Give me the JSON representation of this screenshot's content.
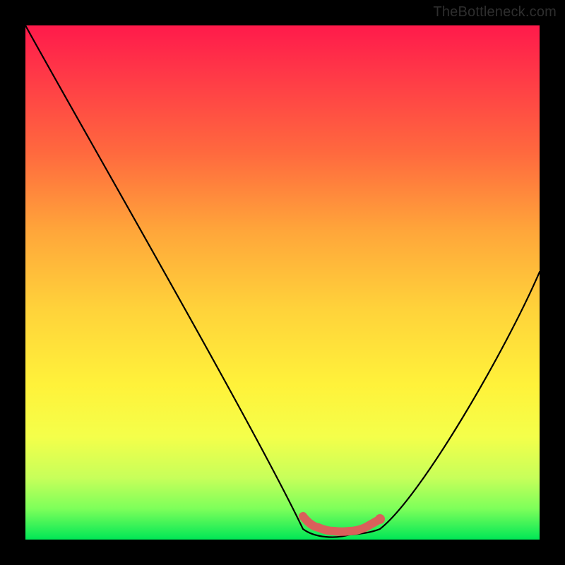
{
  "attribution": "TheBottleneck.com",
  "chart_data": {
    "type": "line",
    "title": "",
    "xlabel": "",
    "ylabel": "",
    "xlim": [
      0,
      100
    ],
    "ylim": [
      0,
      100
    ],
    "grid": false,
    "series": [
      {
        "name": "curve",
        "color": "#000000",
        "x": [
          0,
          54,
          63,
          69,
          100
        ],
        "y": [
          100,
          2,
          1,
          2,
          52
        ]
      },
      {
        "name": "highlight",
        "color": "#d9605b",
        "x": [
          54,
          57,
          60,
          63,
          66,
          69
        ],
        "y": [
          4.5,
          2.3,
          1.6,
          1.6,
          2.3,
          4.0
        ]
      }
    ],
    "background_gradient": {
      "top": "#ff1a4b",
      "bottom": "#00e756"
    }
  }
}
